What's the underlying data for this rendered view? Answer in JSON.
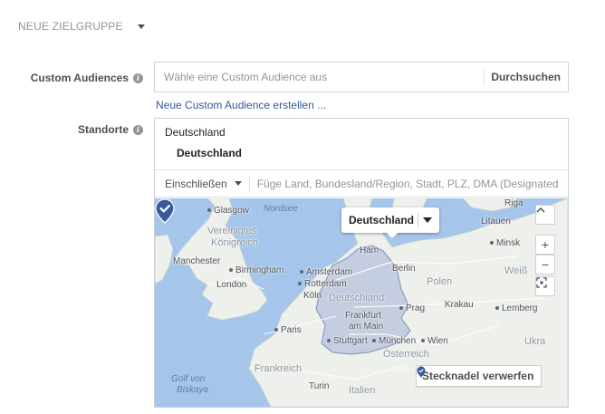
{
  "section": {
    "title": "NEUE ZIELGRUPPE"
  },
  "custom_audiences": {
    "label": "Custom Audiences",
    "placeholder": "Wähle eine Custom Audience aus",
    "browse_label": "Durchsuchen",
    "create_link": "Neue Custom Audience erstellen ..."
  },
  "locations": {
    "label": "Standorte",
    "group_title": "Deutschland",
    "selected_item": "Deutschland",
    "include_label": "Einschließen",
    "search_placeholder": "Füge Land, Bundesland/Region, Stadt, PLZ, DMA (Designated Market Area) oder Adresse hinzu"
  },
  "map": {
    "popup_label": "Deutschland",
    "discard_pin_label": "Stecknadel verwerfen",
    "zoom_in": "+",
    "zoom_out": "−",
    "labels": {
      "glasgow": "Glasgow",
      "nordsee": "Nordsee",
      "vereinigtes": "Vereinigtes",
      "koenigreich": "Königreich",
      "manchester": "Manchester",
      "birmingham": "Birmingham",
      "london": "London",
      "amsterdam": "Amsterdam",
      "rotterdam": "Rotterdam",
      "koeln": "Köln",
      "deutschland": "Deutschland",
      "hamburg": "Ham",
      "berlin": "Berlin",
      "polen": "Polen",
      "krakau": "Krakau",
      "prag": "Prag",
      "frankfurt": "Frankfurt",
      "am_main": "am Main",
      "paris": "Paris",
      "stuttgart": "Stuttgart",
      "muenchen": "München",
      "wien": "Wien",
      "oesterreich": "Österreich",
      "frankreich": "Frankreich",
      "golf": "Golf von",
      "biskaya": "Biskaya",
      "turin": "Turin",
      "italien": "Italien",
      "riga": "Riga",
      "litauen": "Litauen",
      "minsk": "Minsk",
      "weiss": "Weiß",
      "lemberg": "Lemberg",
      "ukra": "Ukra"
    }
  },
  "colors": {
    "link": "#365899",
    "sea": "#a5c6ea",
    "land": "#eef0ec",
    "highlight": "#b7c1dd",
    "pin": "#3b5998"
  }
}
